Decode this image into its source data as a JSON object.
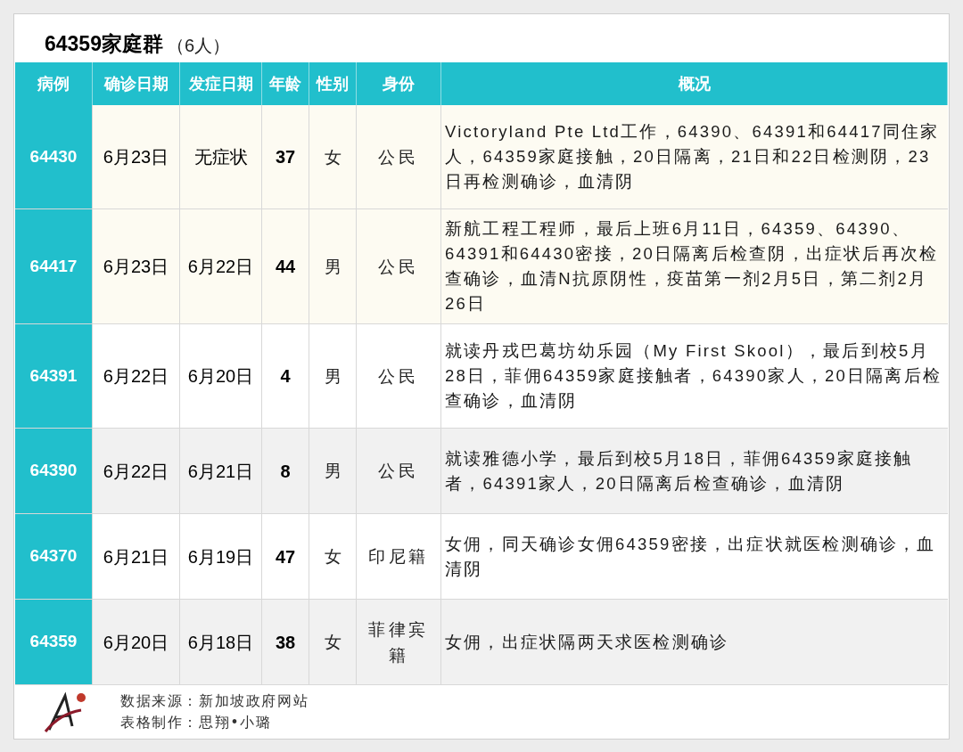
{
  "title": {
    "name": "64359家庭群",
    "count": "（6人）"
  },
  "table": {
    "columns": [
      "病例",
      "确诊日期",
      "发症日期",
      "年龄",
      "性别",
      "身份",
      "概况"
    ],
    "rows": [
      {
        "kind": "highlight",
        "case": "64430",
        "confirmed": "6月23日",
        "onset": "无症状",
        "age": "37",
        "sex": "女",
        "status": "公民",
        "summary": "Victoryland Pte Ltd工作，64390、64391和64417同住家人，64359家庭接触，20日隔离，21日和22日检测阴，23日再检测确诊，血清阴"
      },
      {
        "kind": "highlight",
        "case": "64417",
        "confirmed": "6月23日",
        "onset": "6月22日",
        "age": "44",
        "sex": "男",
        "status": "公民",
        "summary": "新航工程工程师，最后上班6月11日，64359、64390、64391和64430密接，20日隔离后检查阴，出症状后再次检查确诊，血清N抗原阴性，疫苗第一剂2月5日，第二剂2月26日"
      },
      {
        "kind": "plain",
        "case": "64391",
        "confirmed": "6月22日",
        "onset": "6月20日",
        "age": "4",
        "sex": "男",
        "status": "公民",
        "summary": "就读丹戎巴葛坊幼乐园（My First Skool），最后到校5月28日，菲佣64359家庭接触者，64390家人，20日隔离后检查确诊，血清阴"
      },
      {
        "kind": "shaded",
        "case": "64390",
        "confirmed": "6月22日",
        "onset": "6月21日",
        "age": "8",
        "sex": "男",
        "status": "公民",
        "summary": "就读雅德小学，最后到校5月18日，菲佣64359家庭接触者，64391家人，20日隔离后检查确诊，血清阴"
      },
      {
        "kind": "plain",
        "case": "64370",
        "confirmed": "6月21日",
        "onset": "6月19日",
        "age": "47",
        "sex": "女",
        "status": "印尼籍",
        "summary": "女佣，同天确诊女佣64359密接，出症状就医检测确诊，血清阴"
      },
      {
        "kind": "shaded",
        "case": "64359",
        "confirmed": "6月20日",
        "onset": "6月18日",
        "age": "38",
        "sex": "女",
        "status": "菲律宾籍",
        "summary": "女佣，出症状隔两天求医检测确诊"
      }
    ]
  },
  "footer": {
    "source": "数据来源：新加坡政府网站",
    "author": "表格制作：思翔•小璐"
  }
}
